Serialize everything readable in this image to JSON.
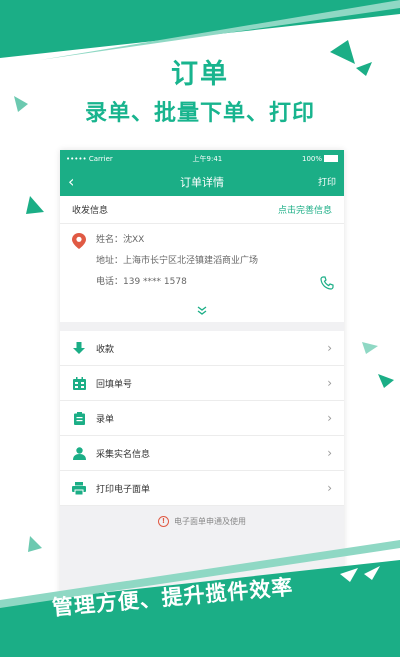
{
  "headline": {
    "title": "订单",
    "subtitle": "录单、批量下单、打印"
  },
  "phone": {
    "status_bar": {
      "carrier": "••••• Carrier",
      "time": "上午9:41",
      "battery": "100%"
    },
    "nav": {
      "title": "订单详情",
      "back_icon": "chevron-left-icon",
      "print_label": "打印"
    },
    "shipping_info": {
      "header": "收发信息",
      "complete_link": "点击完善信息",
      "name_line": "姓名：沈XX",
      "address_line": "地址：上海市长宁区北泾镇建滔商业广场",
      "phone_line": "电话：139 **** 1578"
    },
    "menu": [
      {
        "label": "收款",
        "icon": "payment-download-icon"
      },
      {
        "label": "回填单号",
        "icon": "calendar-icon"
      },
      {
        "label": "录单",
        "icon": "clipboard-icon"
      },
      {
        "label": "采集实名信息",
        "icon": "user-icon"
      },
      {
        "label": "打印电子面单",
        "icon": "printer-icon"
      }
    ],
    "notice": "电子面单申通及使用"
  },
  "banner": {
    "slogan": "管理方便、提升揽件效率"
  },
  "colors": {
    "brand": "#1bae86",
    "headline": "#18b48e",
    "pin": "#e05a44"
  }
}
